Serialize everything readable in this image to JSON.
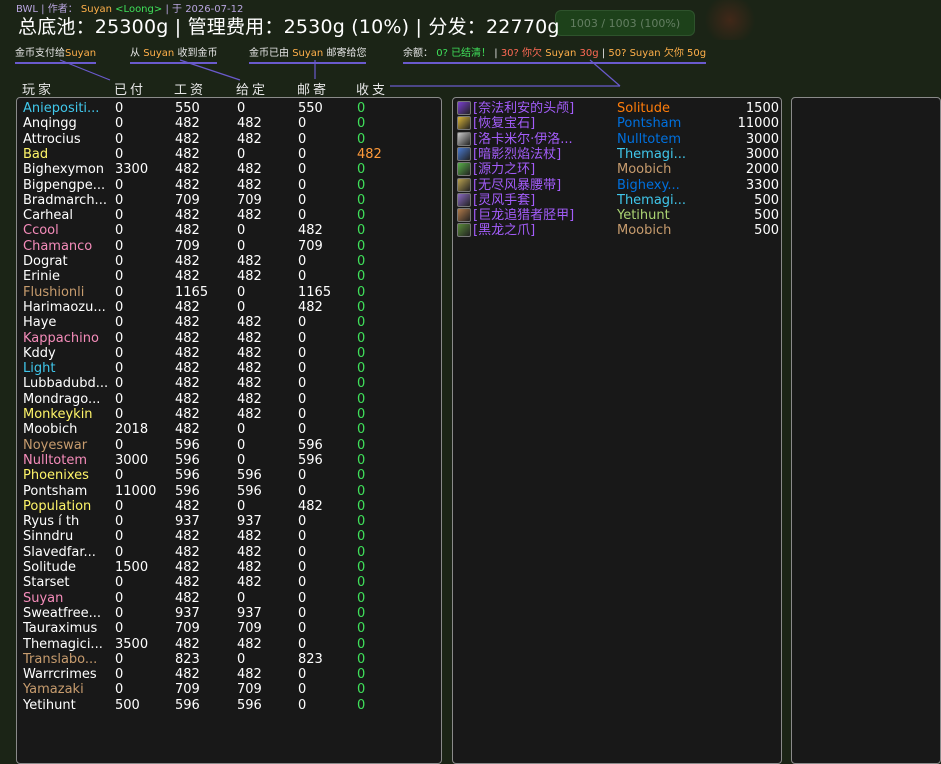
{
  "header": {
    "raid": "BWL",
    "author_label": "作者：",
    "author": "Suyan",
    "guild": "<Loong>",
    "date_label": "于",
    "date": "2026-07-12",
    "title": "总底池：25300g | 管理费用：2530g (10%) | 分发：22770g"
  },
  "background": {
    "hint": "1003 / 1003 (100%)"
  },
  "legend": {
    "pay_to": "金币支付给",
    "pay_to_name": "Suyan",
    "received_from_prefix": "从",
    "received_from_name": "Suyan",
    "received_from_suffix": "收到金币",
    "mailed_prefix": "金币已由",
    "mailed_name": "Suyan",
    "mailed_suffix": "邮寄给您",
    "balance_label": "余额：",
    "balance_zero": "0",
    "balance_zero_text": "已结清！",
    "balance_neg_amount": "30",
    "balance_neg_text": "你欠",
    "balance_neg_name": "Suyan",
    "balance_neg_value": "30g",
    "balance_pos_amount": "50",
    "balance_pos_name": "Suyan",
    "balance_pos_text": "欠你",
    "balance_pos_value": "50g",
    "sep": "|"
  },
  "columns": {
    "player": "玩家",
    "paid": "已付",
    "wage": "工资",
    "given": "给定",
    "mail": "邮寄",
    "balance": "收支"
  },
  "colors": {
    "class_hunter": "#abd473",
    "class_mage": "#40c7eb",
    "class_paladin": "#f58cba",
    "class_rogue": "#fff569",
    "class_priest": "#ffffff",
    "class_warrior": "#c79c6e",
    "class_shaman": "#0070de",
    "class_druid": "#ff7d0a",
    "class_warlock": "#a330c9",
    "balance_positive": "#3fe05a",
    "balance_negative": "#ff9a3a",
    "epic": "#a35dfa",
    "frame_accent": "#6a5acd"
  },
  "players": [
    {
      "name": "Aniepositi...",
      "color": "#40c7eb",
      "paid": "0",
      "wage": "550",
      "given": "0",
      "mail": "550",
      "balance": "0"
    },
    {
      "name": "Anqingg",
      "color": "#ffffff",
      "paid": "0",
      "wage": "482",
      "given": "482",
      "mail": "0",
      "balance": "0"
    },
    {
      "name": "Attrocius",
      "color": "#ffffff",
      "paid": "0",
      "wage": "482",
      "given": "482",
      "mail": "0",
      "balance": "0"
    },
    {
      "name": "Bad",
      "color": "#fff569",
      "paid": "0",
      "wage": "482",
      "given": "0",
      "mail": "0",
      "balance": "482"
    },
    {
      "name": "Bighexymon",
      "color": "#ffffff",
      "paid": "3300",
      "wage": "482",
      "given": "482",
      "mail": "0",
      "balance": "0"
    },
    {
      "name": "Bigpengpe...",
      "color": "#ffffff",
      "paid": "0",
      "wage": "482",
      "given": "482",
      "mail": "0",
      "balance": "0"
    },
    {
      "name": "Bradmarch...",
      "color": "#ffffff",
      "paid": "0",
      "wage": "709",
      "given": "709",
      "mail": "0",
      "balance": "0"
    },
    {
      "name": "Carheal",
      "color": "#ffffff",
      "paid": "0",
      "wage": "482",
      "given": "482",
      "mail": "0",
      "balance": "0"
    },
    {
      "name": "Ccool",
      "color": "#f58cba",
      "paid": "0",
      "wage": "482",
      "given": "0",
      "mail": "482",
      "balance": "0"
    },
    {
      "name": "Chamanco",
      "color": "#f58cba",
      "paid": "0",
      "wage": "709",
      "given": "0",
      "mail": "709",
      "balance": "0"
    },
    {
      "name": "Dograt",
      "color": "#ffffff",
      "paid": "0",
      "wage": "482",
      "given": "482",
      "mail": "0",
      "balance": "0"
    },
    {
      "name": "Erinie",
      "color": "#ffffff",
      "paid": "0",
      "wage": "482",
      "given": "482",
      "mail": "0",
      "balance": "0"
    },
    {
      "name": "Flushionli",
      "color": "#c79c6e",
      "paid": "0",
      "wage": "1165",
      "given": "0",
      "mail": "1165",
      "balance": "0"
    },
    {
      "name": "Harimaozu...",
      "color": "#ffffff",
      "paid": "0",
      "wage": "482",
      "given": "0",
      "mail": "482",
      "balance": "0"
    },
    {
      "name": "Haye",
      "color": "#ffffff",
      "paid": "0",
      "wage": "482",
      "given": "482",
      "mail": "0",
      "balance": "0"
    },
    {
      "name": "Kappachino",
      "color": "#f58cba",
      "paid": "0",
      "wage": "482",
      "given": "482",
      "mail": "0",
      "balance": "0"
    },
    {
      "name": "Kddy",
      "color": "#ffffff",
      "paid": "0",
      "wage": "482",
      "given": "482",
      "mail": "0",
      "balance": "0"
    },
    {
      "name": "Light",
      "color": "#40c7eb",
      "paid": "0",
      "wage": "482",
      "given": "482",
      "mail": "0",
      "balance": "0"
    },
    {
      "name": "Lubbadubd...",
      "color": "#ffffff",
      "paid": "0",
      "wage": "482",
      "given": "482",
      "mail": "0",
      "balance": "0"
    },
    {
      "name": "Mondrago...",
      "color": "#ffffff",
      "paid": "0",
      "wage": "482",
      "given": "482",
      "mail": "0",
      "balance": "0"
    },
    {
      "name": "Monkeykin",
      "color": "#fff569",
      "paid": "0",
      "wage": "482",
      "given": "482",
      "mail": "0",
      "balance": "0"
    },
    {
      "name": "Moobich",
      "color": "#ffffff",
      "paid": "2018",
      "wage": "482",
      "given": "0",
      "mail": "0",
      "balance": "0"
    },
    {
      "name": "Noyeswar",
      "color": "#c79c6e",
      "paid": "0",
      "wage": "596",
      "given": "0",
      "mail": "596",
      "balance": "0"
    },
    {
      "name": "Nulltotem",
      "color": "#f58cba",
      "paid": "3000",
      "wage": "596",
      "given": "0",
      "mail": "596",
      "balance": "0"
    },
    {
      "name": "Phoenixes",
      "color": "#fff569",
      "paid": "0",
      "wage": "596",
      "given": "596",
      "mail": "0",
      "balance": "0"
    },
    {
      "name": "Pontsham",
      "color": "#ffffff",
      "paid": "11000",
      "wage": "596",
      "given": "596",
      "mail": "0",
      "balance": "0"
    },
    {
      "name": "Population",
      "color": "#fff569",
      "paid": "0",
      "wage": "482",
      "given": "0",
      "mail": "482",
      "balance": "0"
    },
    {
      "name": "Ryus í th",
      "color": "#ffffff",
      "paid": "0",
      "wage": "937",
      "given": "937",
      "mail": "0",
      "balance": "0"
    },
    {
      "name": "Sinndru",
      "color": "#ffffff",
      "paid": "0",
      "wage": "482",
      "given": "482",
      "mail": "0",
      "balance": "0"
    },
    {
      "name": "Slavedfar...",
      "color": "#ffffff",
      "paid": "0",
      "wage": "482",
      "given": "482",
      "mail": "0",
      "balance": "0"
    },
    {
      "name": "Solitude",
      "color": "#ffffff",
      "paid": "1500",
      "wage": "482",
      "given": "482",
      "mail": "0",
      "balance": "0"
    },
    {
      "name": "Starset",
      "color": "#ffffff",
      "paid": "0",
      "wage": "482",
      "given": "482",
      "mail": "0",
      "balance": "0"
    },
    {
      "name": "Suyan",
      "color": "#f58cba",
      "paid": "0",
      "wage": "482",
      "given": "0",
      "mail": "0",
      "balance": "0"
    },
    {
      "name": "Sweatfree...",
      "color": "#ffffff",
      "paid": "0",
      "wage": "937",
      "given": "937",
      "mail": "0",
      "balance": "0"
    },
    {
      "name": "Tauraximus",
      "color": "#ffffff",
      "paid": "0",
      "wage": "709",
      "given": "709",
      "mail": "0",
      "balance": "0"
    },
    {
      "name": "Themagici...",
      "color": "#ffffff",
      "paid": "3500",
      "wage": "482",
      "given": "482",
      "mail": "0",
      "balance": "0"
    },
    {
      "name": "Translabo...",
      "color": "#c79c6e",
      "paid": "0",
      "wage": "823",
      "given": "0",
      "mail": "823",
      "balance": "0"
    },
    {
      "name": "Warrcrimes",
      "color": "#ffffff",
      "paid": "0",
      "wage": "482",
      "given": "482",
      "mail": "0",
      "balance": "0"
    },
    {
      "name": "Yamazaki",
      "color": "#c79c6e",
      "paid": "0",
      "wage": "709",
      "given": "709",
      "mail": "0",
      "balance": "0"
    },
    {
      "name": "Yetihunt",
      "color": "#ffffff",
      "paid": "500",
      "wage": "596",
      "given": "596",
      "mail": "0",
      "balance": "0"
    }
  ],
  "items": [
    {
      "name": "[奈法利安的头颅]",
      "icon": "head-icon",
      "icon_color": "#7a3fd0",
      "winner": "Solitude",
      "winner_color": "#ff7d0a",
      "price": "1500"
    },
    {
      "name": "[恢复宝石]",
      "icon": "gem-icon",
      "icon_color": "#d9b43a",
      "winner": "Pontsham",
      "winner_color": "#0070de",
      "price": "11000"
    },
    {
      "name": "[洛卡米尔·伊洛...",
      "icon": "rod-icon",
      "icon_color": "#c9c9c9",
      "winner": "Nulltotem",
      "winner_color": "#0070de",
      "price": "3000"
    },
    {
      "name": "[暗影烈焰法杖]",
      "icon": "staff-icon",
      "icon_color": "#4a7ad0",
      "winner": "Themagi...",
      "winner_color": "#40c7eb",
      "price": "3000"
    },
    {
      "name": "[源力之环]",
      "icon": "ring-icon",
      "icon_color": "#5ab04a",
      "winner": "Moobich",
      "winner_color": "#c79c6e",
      "price": "2000"
    },
    {
      "name": "[无尽风暴腰带]",
      "icon": "belt-icon",
      "icon_color": "#b8a050",
      "winner": "Bighexy...",
      "winner_color": "#0070de",
      "price": "3300"
    },
    {
      "name": "[灵风手套]",
      "icon": "gloves-icon",
      "icon_color": "#8a6ac0",
      "winner": "Themagi...",
      "winner_color": "#40c7eb",
      "price": "500"
    },
    {
      "name": "[巨龙追猎者胫甲]",
      "icon": "boots-icon",
      "icon_color": "#b07a4a",
      "winner": "Yetihunt",
      "winner_color": "#abd473",
      "price": "500"
    },
    {
      "name": "[黑龙之爪]",
      "icon": "claw-icon",
      "icon_color": "#5a8a3a",
      "winner": "Moobich",
      "winner_color": "#c79c6e",
      "price": "500"
    }
  ]
}
